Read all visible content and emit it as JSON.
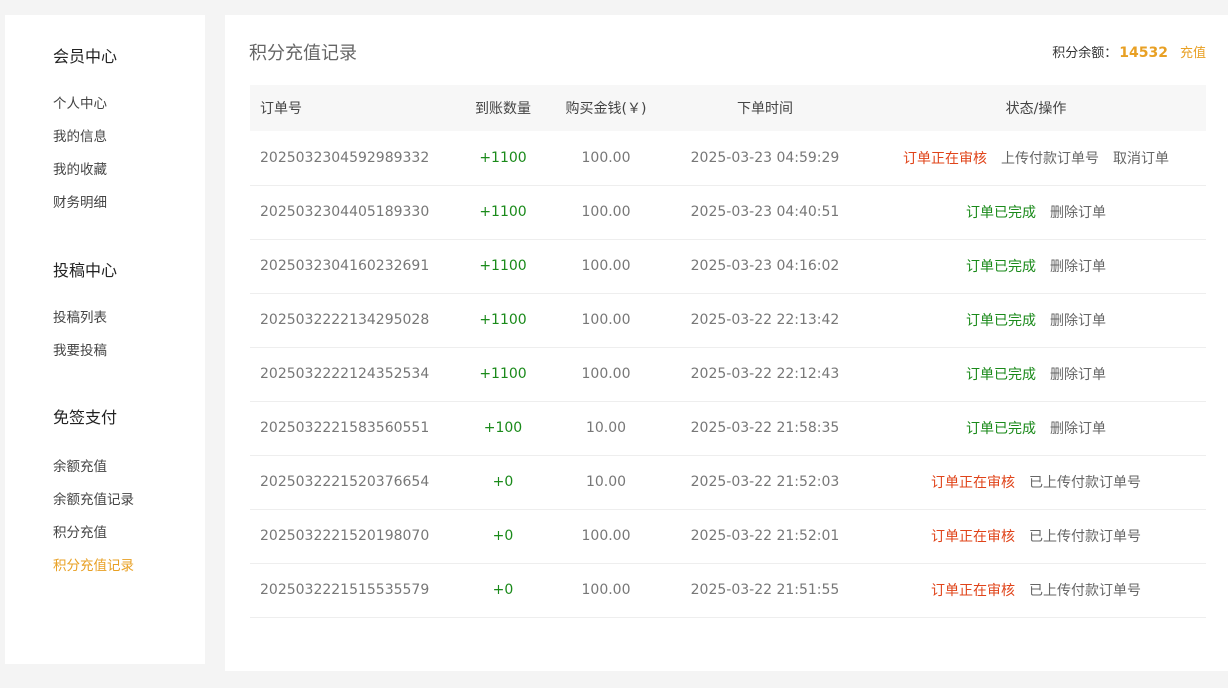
{
  "sidebar": {
    "groups": [
      {
        "title": "会员中心",
        "items": [
          "个人中心",
          "我的信息",
          "我的收藏",
          "财务明细"
        ]
      },
      {
        "title": "投稿中心",
        "items": [
          "投稿列表",
          "我要投稿"
        ]
      },
      {
        "title": "免签支付",
        "items": [
          "余额充值",
          "余额充值记录",
          "积分充值",
          "积分充值记录"
        ]
      }
    ],
    "active_item": "积分充值记录",
    "colors": {
      "active": "#e8a024"
    }
  },
  "main": {
    "title": "积分充值记录",
    "balance_label": "积分余额：",
    "balance_value": "14532",
    "recharge_label": "充值",
    "table": {
      "headers": [
        "订单号",
        "到账数量",
        "购买金钱(￥)",
        "下单时间",
        "状态/操作"
      ],
      "rows": [
        {
          "order_no": "2025032304592989332",
          "qty": "+1100",
          "money": "100.00",
          "time": "2025-03-23 04:59:29",
          "status": "订单正在审核",
          "actions": [
            "上传付款订单号",
            "取消订单"
          ]
        },
        {
          "order_no": "2025032304405189330",
          "qty": "+1100",
          "money": "100.00",
          "time": "2025-03-23 04:40:51",
          "status": "订单已完成",
          "actions": [
            "删除订单"
          ]
        },
        {
          "order_no": "2025032304160232691",
          "qty": "+1100",
          "money": "100.00",
          "time": "2025-03-23 04:16:02",
          "status": "订单已完成",
          "actions": [
            "删除订单"
          ]
        },
        {
          "order_no": "2025032222134295028",
          "qty": "+1100",
          "money": "100.00",
          "time": "2025-03-22 22:13:42",
          "status": "订单已完成",
          "actions": [
            "删除订单"
          ]
        },
        {
          "order_no": "2025032222124352534",
          "qty": "+1100",
          "money": "100.00",
          "time": "2025-03-22 22:12:43",
          "status": "订单已完成",
          "actions": [
            "删除订单"
          ]
        },
        {
          "order_no": "2025032221583560551",
          "qty": "+100",
          "money": "10.00",
          "time": "2025-03-22 21:58:35",
          "status": "订单已完成",
          "actions": [
            "删除订单"
          ]
        },
        {
          "order_no": "2025032221520376654",
          "qty": "+0",
          "money": "10.00",
          "time": "2025-03-22 21:52:03",
          "status": "订单正在审核",
          "actions": [
            "已上传付款订单号"
          ]
        },
        {
          "order_no": "2025032221520198070",
          "qty": "+0",
          "money": "100.00",
          "time": "2025-03-22 21:52:01",
          "status": "订单正在审核",
          "actions": [
            "已上传付款订单号"
          ]
        },
        {
          "order_no": "2025032221515535579",
          "qty": "+0",
          "money": "100.00",
          "time": "2025-03-22 21:51:55",
          "status": "订单正在审核",
          "actions": [
            "已上传付款订单号"
          ]
        }
      ]
    },
    "colors": {
      "accent": "#e8a024",
      "success": "#1a8a1a",
      "pending": "#e0441a"
    }
  }
}
